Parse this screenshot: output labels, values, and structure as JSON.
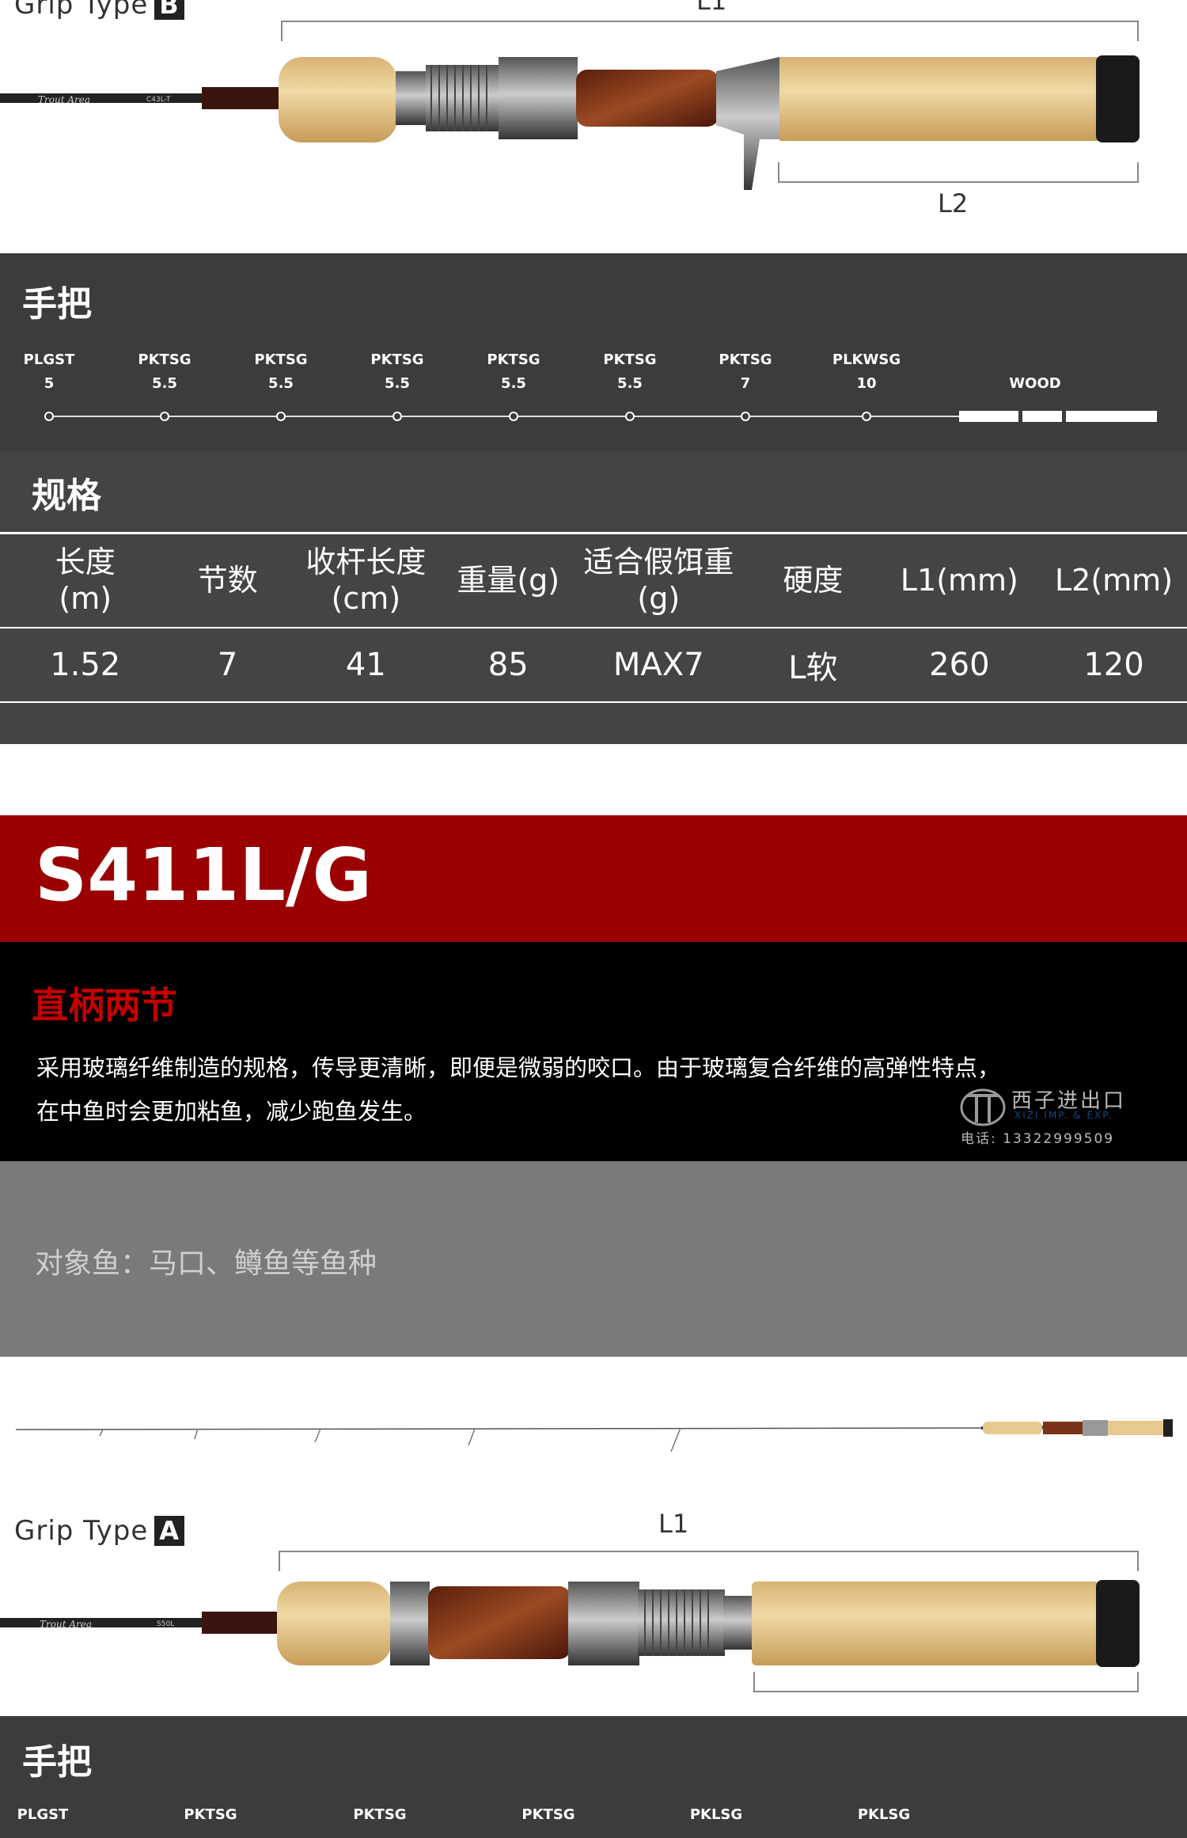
{
  "top_rod": {
    "grip_type_label": "Grip Type",
    "grip_type_letter": "B",
    "l1_label": "L1",
    "l2_label": "L2",
    "rod_engraving": "C43L-T"
  },
  "grip_section": {
    "title": "手把",
    "guides": [
      {
        "name": "PLGST",
        "size": "5"
      },
      {
        "name": "PKTSG",
        "size": "5.5"
      },
      {
        "name": "PKTSG",
        "size": "5.5"
      },
      {
        "name": "PKTSG",
        "size": "5.5"
      },
      {
        "name": "PKTSG",
        "size": "5.5"
      },
      {
        "name": "PKTSG",
        "size": "5.5"
      },
      {
        "name": "PKTSG",
        "size": "7"
      },
      {
        "name": "PLKWSG",
        "size": "10"
      }
    ],
    "wood_label": "WOOD"
  },
  "spec_section": {
    "title": "规格",
    "headers": [
      [
        "长度",
        "(m)"
      ],
      [
        "节数"
      ],
      [
        "收杆长度",
        "(cm)"
      ],
      [
        "重量(g)"
      ],
      [
        "适合假饵重",
        "(g)"
      ],
      [
        "硬度"
      ],
      [
        "L1(mm)"
      ],
      [
        "L2(mm)"
      ]
    ],
    "row": [
      "1.52",
      "7",
      "41",
      "85",
      "MAX7",
      "L软",
      "260",
      "120"
    ]
  },
  "model_banner": {
    "model": "S411L/G"
  },
  "description": {
    "subtitle": "直柄两节",
    "line1": "采用玻璃纤维制造的规格，传导更清晰，即便是微弱的咬口。由于玻璃复合纤维的高弹性特点，",
    "line2": "在中鱼时会更加粘鱼，减少跑鱼发生。",
    "watermark_name": "西子进出口",
    "watermark_en": "XIZI IMP. & EXP.",
    "watermark_phone": "电话: 13322999509"
  },
  "target": {
    "text": "对象鱼：马口、鳟鱼等鱼种"
  },
  "bottom_rod": {
    "grip_type_label": "Grip Type",
    "grip_type_letter": "A",
    "l1_label": "L1",
    "rod_engraving": "S50L"
  },
  "grip_section_2": {
    "title": "手把",
    "guides": [
      {
        "name": "PLGST"
      },
      {
        "name": "PKTSG"
      },
      {
        "name": "PKTSG"
      },
      {
        "name": "PKTSG"
      },
      {
        "name": "PKLSG"
      },
      {
        "name": "PKLSG"
      }
    ]
  },
  "colors": {
    "banner_red": "#9a0000",
    "subtitle_red": "#c40000",
    "dark_panel": "#3c3c3c",
    "grey_panel": "#7a7a7a",
    "cork": "#e6c98c",
    "wood": "#7a3218"
  }
}
